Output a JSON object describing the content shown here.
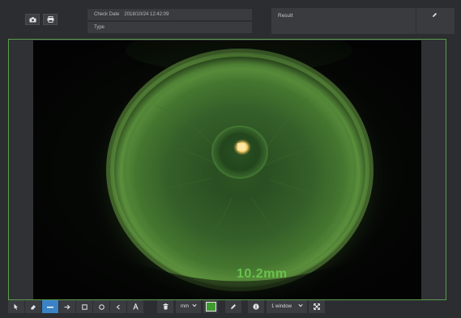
{
  "header": {
    "check_date_label": "Check Date",
    "check_date_value": "2018/10/24 12:42:09",
    "type_label": "Type",
    "result_label": "Result"
  },
  "icons": {
    "camera": "camera-icon",
    "print": "print-icon",
    "edit": "pencil-icon"
  },
  "viewer": {
    "measurement": "10.2mm",
    "accent_color": "#5a9c4d"
  },
  "toolbar": {
    "tools": [
      "pointer",
      "eraser",
      "line",
      "arrow",
      "rectangle",
      "circle",
      "angle",
      "text"
    ],
    "active_tool": "line",
    "unit": "mm",
    "stroke_color": "#3d9b2f",
    "window_layout": "1 window"
  }
}
